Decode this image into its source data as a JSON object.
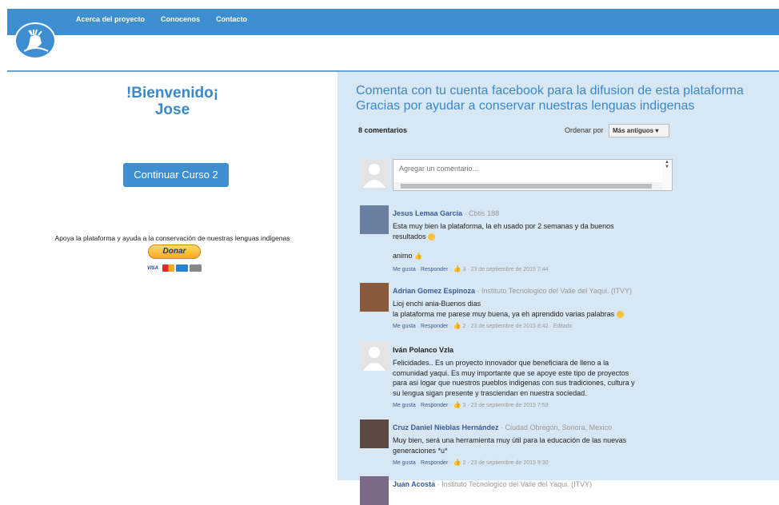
{
  "nav": [
    "Acerca del proyecto",
    "Conocenos",
    "Contacto"
  ],
  "welcome": {
    "line1": "!Bienvenido¡",
    "line2": "Jose"
  },
  "continue_button": "Continuar Curso  2",
  "support_text": "Apoya la plataforma y ayuda a la conservación de nuestras lenguas indigenas",
  "donate_button": "Donar",
  "visa_label": "VISA",
  "cta": {
    "line1": "Comenta con tu cuenta facebook para la difusion de esta plataforma",
    "line2": "Gracias por ayudar a conservar nuestras lenguas indigenas"
  },
  "comments_count": "8 comentarios",
  "sort_label": "Ordenar por",
  "sort_value": "Más antiguos ▾",
  "compose_placeholder": "Agregar un comentario...",
  "comments": [
    {
      "author": "Jesus Lemaa Garcia",
      "affil": " · Cbtis 188",
      "line1": "Esta muy bien la plataforma, la eh usado por 2 semanas y da buenos",
      "line2": "resultados",
      "line3": "animo",
      "like": "Me gusta",
      "reply": "Responder",
      "likes": "3",
      "date": "23 de septiembre de 2015 7:44",
      "colors": {
        "avatar": "#6b7fa0"
      }
    },
    {
      "author": "Adrian Gomez Espinoza",
      "affil": " · Instituto Tecnologico del Valle del Yaqui. (ITVY)",
      "line1": "Lioj enchi ania-Buenos dias",
      "line2": "la plataforma me parese muy buena, ya eh aprendido varias palabras",
      "like": "Me gusta",
      "reply": "Responder",
      "likes": "2",
      "date": "23 de septiembre de 2015 8:42",
      "edited": " · Editado",
      "colors": {
        "avatar": "#8a5a3c"
      }
    },
    {
      "author": "Iván Polanco Vzla",
      "line1": "Felicidades.. Es un proyecto innovador que beneficiara de lleno a la",
      "line2": "comunidad yaqui. Es muy importante que se apoye este tipo de proyectos",
      "line3": "para asi logar que nuestros pueblos indigenas con sus tradiciones, cultura y",
      "line4": "su lengua sigan presente y trasciendan en nuestra sociedad.",
      "like": "Me gusta",
      "reply": "Responder",
      "likes": "3",
      "date": "23 de septiembre de 2015 7:53",
      "colors": {
        "avatar": "#e4e4e4"
      }
    },
    {
      "author": "Cruz Daniel Nieblas Hernández",
      "affil": " · Ciudad Obregón, Sonora, Mexico",
      "line1": "Muy bien, será una herramienta muy útil para la educación de las nuevas",
      "line2": "generaciones *u*",
      "like": "Me gusta",
      "reply": "Responder",
      "likes": "2",
      "date": "23 de septiembre de 2015 9:30",
      "colors": {
        "avatar": "#5a4a42"
      }
    },
    {
      "author": "Juan Acosta",
      "affil": " · Instituto Tecnologico del Valle del Yaqui. (ITVY)",
      "colors": {
        "avatar": "#7a6a88"
      }
    }
  ],
  "colors": {
    "accent": "#3d8fd1",
    "panel": "#d7e8f4",
    "fb_link": "#3b5998"
  }
}
